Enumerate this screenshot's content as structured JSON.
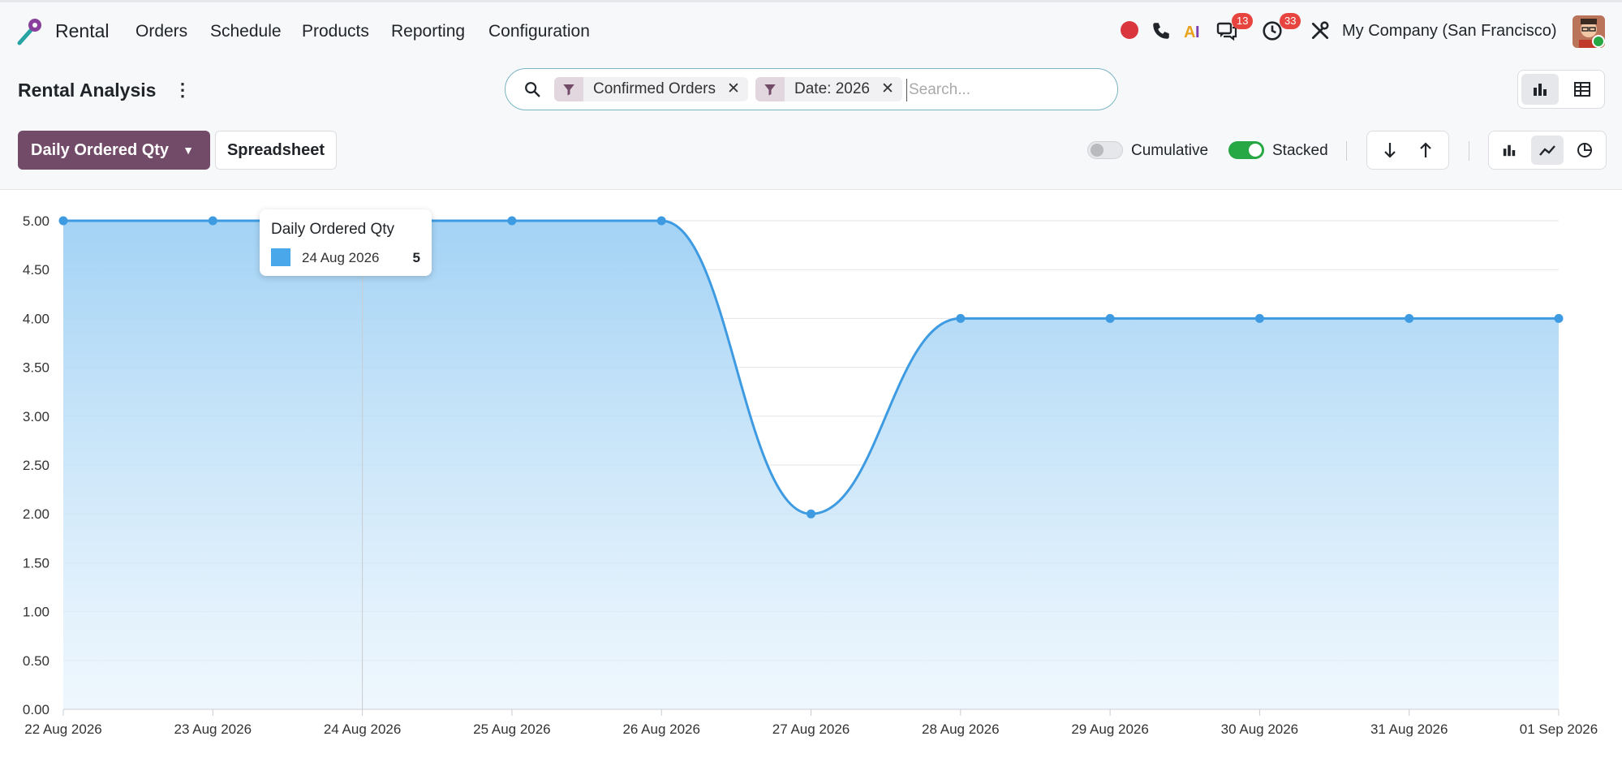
{
  "app": {
    "name": "Rental"
  },
  "menu": [
    "Orders",
    "Schedule",
    "Products",
    "Reporting",
    "Configuration"
  ],
  "systray": {
    "discuss_count": "13",
    "activity_count": "33",
    "company": "My Company (San Francisco)"
  },
  "page": {
    "title": "Rental Analysis"
  },
  "search": {
    "facets": [
      {
        "label": "Confirmed Orders"
      },
      {
        "label": "Date: 2026"
      }
    ],
    "placeholder": "Search..."
  },
  "controls": {
    "measure_label": "Daily Ordered Qty",
    "spreadsheet_label": "Spreadsheet",
    "cumulative_label": "Cumulative",
    "cumulative_on": false,
    "stacked_label": "Stacked",
    "stacked_on": true
  },
  "colors": {
    "accent": "#714b67",
    "series": "#3e9be2",
    "toggle_on": "#28a745"
  },
  "tooltip": {
    "title": "Daily Ordered Qty",
    "label": "24 Aug 2026",
    "value": "5"
  },
  "chart_data": {
    "type": "area",
    "x": [
      "22 Aug 2026",
      "23 Aug 2026",
      "24 Aug 2026",
      "25 Aug 2026",
      "26 Aug 2026",
      "27 Aug 2026",
      "28 Aug 2026",
      "29 Aug 2026",
      "30 Aug 2026",
      "31 Aug 2026",
      "01 Sep 2026"
    ],
    "series": [
      {
        "name": "Daily Ordered Qty",
        "values": [
          5,
          5,
          5,
          5,
          5,
          2,
          4,
          4,
          4,
          4,
          4
        ]
      }
    ],
    "ylim": [
      0,
      5
    ],
    "yticks": [
      "0.00",
      "0.50",
      "1.00",
      "1.50",
      "2.00",
      "2.50",
      "3.00",
      "3.50",
      "4.00",
      "4.50",
      "5.00"
    ],
    "grid": true
  }
}
